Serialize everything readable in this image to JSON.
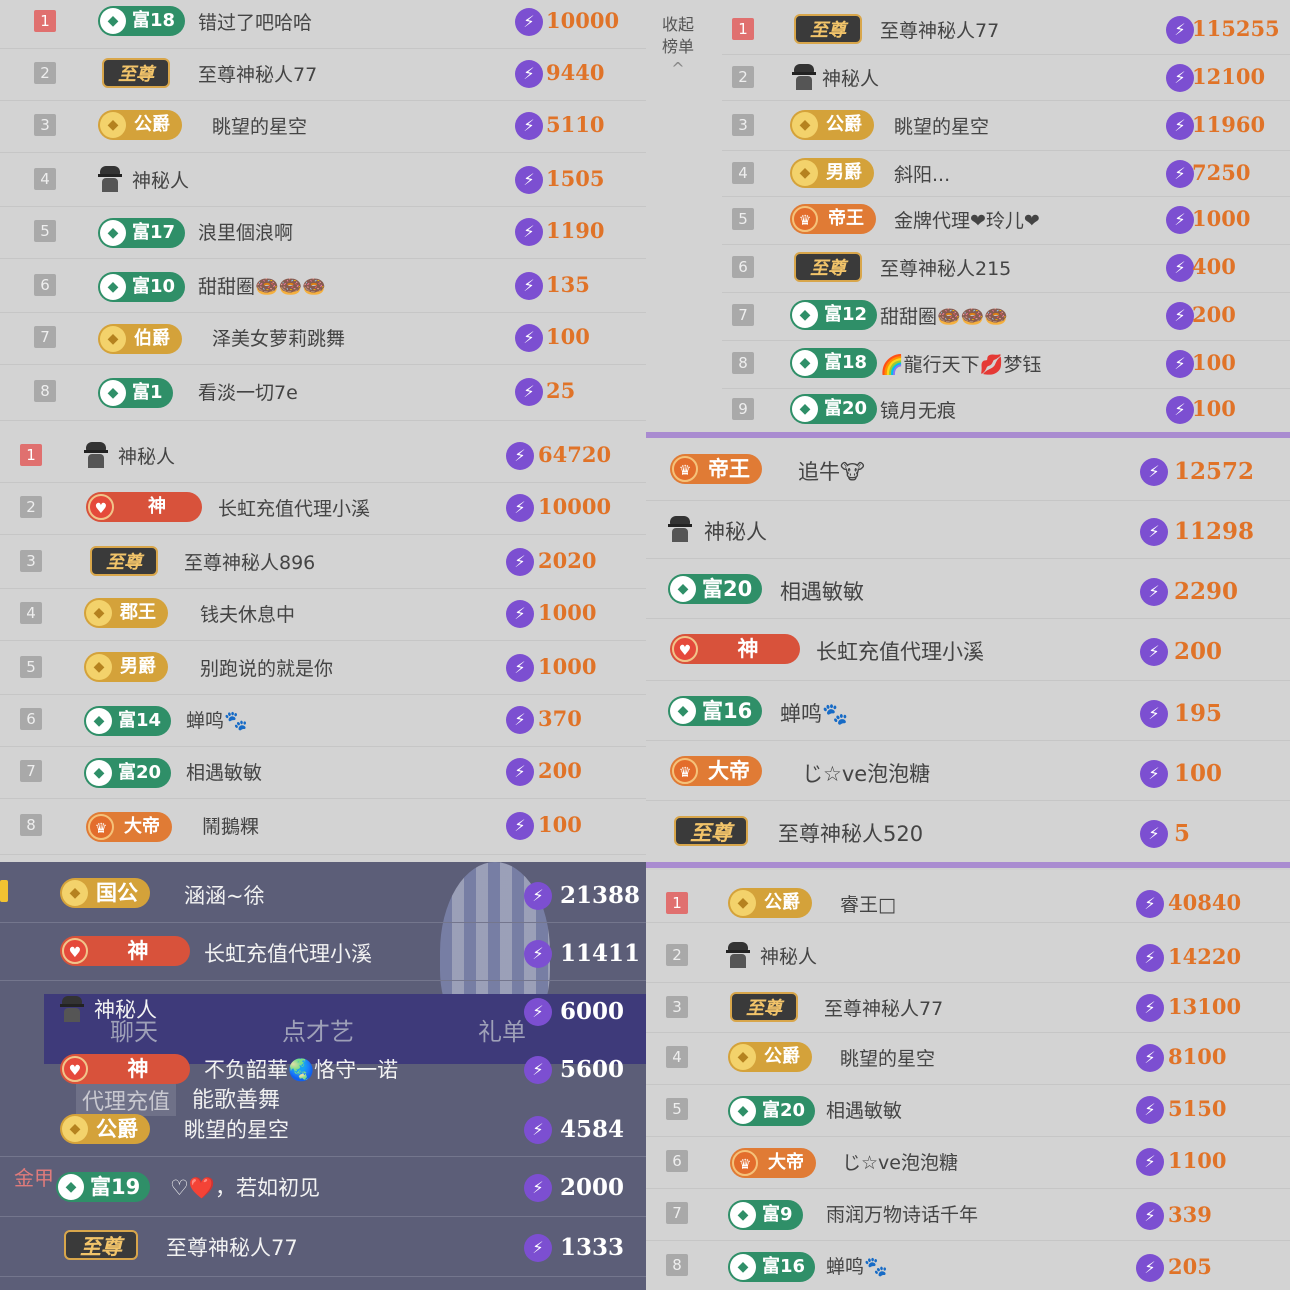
{
  "panel1": {
    "rows": [
      {
        "rank": "1",
        "badge": "富18",
        "name": "错过了吧哈哈",
        "value": "10000"
      },
      {
        "rank": "2",
        "badge": "至尊",
        "name": "至尊神秘人77",
        "value": "9440"
      },
      {
        "rank": "3",
        "badge": "公爵",
        "name": "眺望的星空",
        "value": "5110"
      },
      {
        "rank": "4",
        "badge": "",
        "name": "神秘人",
        "value": "1505"
      },
      {
        "rank": "5",
        "badge": "富17",
        "name": "浪里個浪啊",
        "value": "1190"
      },
      {
        "rank": "6",
        "badge": "富10",
        "name": "甜甜圈🍩🍩🍩",
        "value": "135"
      },
      {
        "rank": "7",
        "badge": "伯爵",
        "name": "泽美女萝莉跳舞",
        "value": "100"
      },
      {
        "rank": "8",
        "badge": "富1",
        "name": "看淡一切7e",
        "value": "25"
      }
    ]
  },
  "panel2": {
    "collapse_label": "收起榜单",
    "collapse_arrow": "^",
    "rows": [
      {
        "rank": "1",
        "badge": "至尊",
        "name": "至尊神秘人77",
        "value": "115255"
      },
      {
        "rank": "2",
        "badge": "",
        "name": "神秘人",
        "value": "12100"
      },
      {
        "rank": "3",
        "badge": "公爵",
        "name": "眺望的星空",
        "value": "11960"
      },
      {
        "rank": "4",
        "badge": "男爵",
        "name": "斜阳...",
        "value": "7250"
      },
      {
        "rank": "5",
        "badge": "帝王",
        "name": "金牌代理❤玲儿❤",
        "value": "1000"
      },
      {
        "rank": "6",
        "badge": "至尊",
        "name": "至尊神秘人215",
        "value": "400"
      },
      {
        "rank": "7",
        "badge": "富12",
        "name": "甜甜圈🍩🍩🍩",
        "value": "200"
      },
      {
        "rank": "8",
        "badge": "富18",
        "name": "🌈龍行天下💋梦钰",
        "value": "100"
      },
      {
        "rank": "9",
        "badge": "富20",
        "name": "镜月无痕",
        "value": "100"
      }
    ]
  },
  "panel3": {
    "rows": [
      {
        "rank": "1",
        "badge": "",
        "name": "神秘人",
        "value": "64720"
      },
      {
        "rank": "2",
        "badge": "神",
        "name": "长虹充值代理小溪",
        "value": "10000"
      },
      {
        "rank": "3",
        "badge": "至尊",
        "name": "至尊神秘人896",
        "value": "2020"
      },
      {
        "rank": "4",
        "badge": "郡王",
        "name": "钱夫休息中",
        "value": "1000"
      },
      {
        "rank": "5",
        "badge": "男爵",
        "name": "别跑说的就是你",
        "value": "1000"
      },
      {
        "rank": "6",
        "badge": "富14",
        "name": "蝉鸣🐾",
        "value": "370"
      },
      {
        "rank": "7",
        "badge": "富20",
        "name": "相遇敏敏",
        "value": "200"
      },
      {
        "rank": "8",
        "badge": "大帝",
        "name": "鬧鵝粿",
        "value": "100"
      }
    ]
  },
  "panel4": {
    "rows": [
      {
        "badge": "帝王",
        "name": "追牛🐮",
        "value": "12572"
      },
      {
        "badge": "",
        "name": "神秘人",
        "value": "11298"
      },
      {
        "badge": "富20",
        "name": "相遇敏敏",
        "value": "2290"
      },
      {
        "badge": "神",
        "name": "长虹充值代理小溪",
        "value": "200"
      },
      {
        "badge": "富16",
        "name": "蝉鸣🐾",
        "value": "195"
      },
      {
        "badge": "大帝",
        "name": "じ☆ve泡泡糖",
        "value": "100"
      },
      {
        "badge": "至尊",
        "name": "至尊神秘人520",
        "value": "5"
      }
    ]
  },
  "panel5": {
    "rows": [
      {
        "badge": "国公",
        "name": "涵涵~徐",
        "value": "21388"
      },
      {
        "badge": "神",
        "name": "长虹充值代理小溪",
        "value": "11411"
      },
      {
        "badge": "",
        "name": "神秘人",
        "value": "6000"
      },
      {
        "badge": "神",
        "name": "不负韶華🌏恪守一诺",
        "value": "5600"
      },
      {
        "badge": "公爵",
        "name": "眺望的星空",
        "value": "4584"
      },
      {
        "badge": "富19",
        "name": "♡❤️，若如初见",
        "value": "2000"
      },
      {
        "badge": "至尊",
        "name": "至尊神秘人77",
        "value": "1333"
      }
    ],
    "overlay": {
      "tab1": "聊天",
      "tab2": "点才艺",
      "tab3": "礼单",
      "chip": "代理充值",
      "chat": "能歌善舞",
      "side1": "金甲"
    }
  },
  "panel6": {
    "rows": [
      {
        "rank": "1",
        "badge": "公爵",
        "name": "睿王□",
        "value": "40840"
      },
      {
        "rank": "2",
        "badge": "",
        "name": "神秘人",
        "value": "14220"
      },
      {
        "rank": "3",
        "badge": "至尊",
        "name": "至尊神秘人77",
        "value": "13100"
      },
      {
        "rank": "4",
        "badge": "公爵",
        "name": "眺望的星空",
        "value": "8100"
      },
      {
        "rank": "5",
        "badge": "富20",
        "name": "相遇敏敏",
        "value": "5150"
      },
      {
        "rank": "6",
        "badge": "大帝",
        "name": "じ☆ve泡泡糖",
        "value": "1100"
      },
      {
        "rank": "7",
        "badge": "富9",
        "name": "雨润万物诗话千年",
        "value": "339"
      },
      {
        "rank": "8",
        "badge": "富16",
        "name": "蝉鸣🐾",
        "value": "205"
      }
    ]
  },
  "icons": {
    "coin": "lightning-coin-icon",
    "spy": "mystery-user-icon"
  },
  "colors": {
    "value": "#e07328",
    "coin": "#7c4fd1",
    "rank_first": "#e0706f",
    "divider": "#a98bd0"
  }
}
